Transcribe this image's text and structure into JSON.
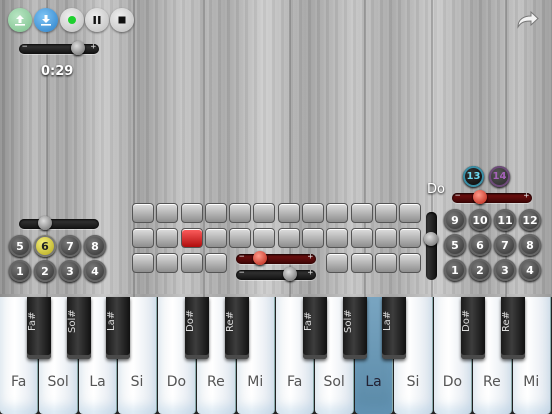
{
  "toolbar": {
    "upload_icon": "upload-icon",
    "download_icon": "download-icon",
    "record_icon": "record-icon",
    "pause_icon": "pause-icon",
    "stop_icon": "stop-icon",
    "redo_icon": "redo-arrow-icon"
  },
  "colors": {
    "accent": "#2a7fc8",
    "record": "#1ed02f",
    "active_pad": "#d41a1a",
    "pressed_key": "#5a8aa8"
  },
  "recorder": {
    "minus": "−",
    "plus": "+",
    "time": "0:29",
    "level": 0.7
  },
  "left_pad": {
    "buttons": [
      "5",
      "6",
      "7",
      "8",
      "1",
      "2",
      "3",
      "4"
    ],
    "selected": "6"
  },
  "mixer": {
    "bottom_minus": "−",
    "bottom_plus": "+",
    "red_minus": "−",
    "red_plus": "+"
  },
  "sequencer": {
    "rows": [
      [
        0,
        0,
        0,
        0,
        0,
        0,
        0,
        0,
        0,
        0,
        0,
        0
      ],
      [
        0,
        0,
        1,
        0,
        0,
        0,
        0,
        0,
        0,
        0,
        0,
        0
      ],
      [
        0,
        0,
        0,
        0,
        -1,
        -1,
        -1,
        -1,
        0,
        0,
        0,
        0
      ]
    ]
  },
  "right_pad": {
    "note": "Do",
    "octave_a": "13",
    "octave_b": "14",
    "buttons": [
      "9",
      "10",
      "11",
      "12",
      "5",
      "6",
      "7",
      "8",
      "1",
      "2",
      "3",
      "4"
    ]
  },
  "keyboard": {
    "white_keys": [
      "Fa",
      "Sol",
      "La",
      "Si",
      "Do",
      "Re",
      "Mi",
      "Fa",
      "Sol",
      "La",
      "Si",
      "Do",
      "Re",
      "Mi"
    ],
    "pressed_white": 9,
    "black_keys": [
      "Fa#",
      "Sol#",
      "La#",
      "Do#",
      "Re#",
      "Fa#",
      "Sol#",
      "La#",
      "Do#",
      "Re#"
    ]
  }
}
